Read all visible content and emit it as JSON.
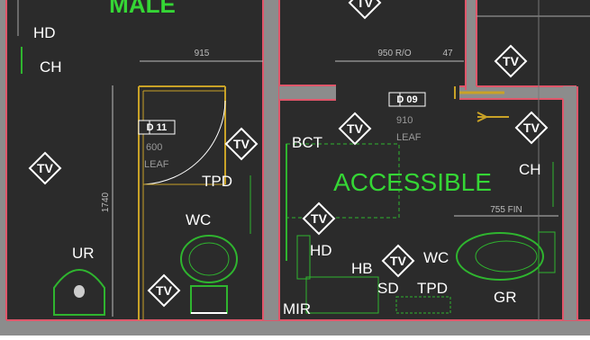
{
  "colors": {
    "background": "#2b2b2b",
    "wall": "#8c8c8c",
    "wall_edge": "#e0566a",
    "fixture": "#2fb52f",
    "door": "#c9a227",
    "accent_label": "#35d635",
    "text": "#ffffff",
    "dimension": "#bdbdbd"
  },
  "room_labels": {
    "male": "MALE",
    "accessible": "ACCESSIBLE"
  },
  "labels": {
    "hd_top": "HD",
    "ch_left": "CH",
    "tpd_left": "TPD",
    "wc_left": "WC",
    "ur": "UR",
    "bct": "BCT",
    "ch_right": "CH",
    "hd_mid": "HD",
    "hb": "HB",
    "wc_right": "WC",
    "sd": "SD",
    "tpd_right": "TPD",
    "gr": "GR",
    "mir": "MIR"
  },
  "dimensions": {
    "d915": "915",
    "d950": "950 R/O",
    "d47": "47",
    "d1740": "1740",
    "d755": "755 FIN"
  },
  "door_tags": {
    "d11": "D 11",
    "d09": "D 09"
  },
  "door_leaf": {
    "d11_width": "600",
    "d11_leaf": "LEAF",
    "d09_width": "910",
    "d09_leaf": "LEAF"
  },
  "symbol_text": "TV",
  "icons": [
    "tv-diamond-icon",
    "door-swing-icon",
    "toilet-icon",
    "urinal-icon",
    "handle-icon"
  ]
}
